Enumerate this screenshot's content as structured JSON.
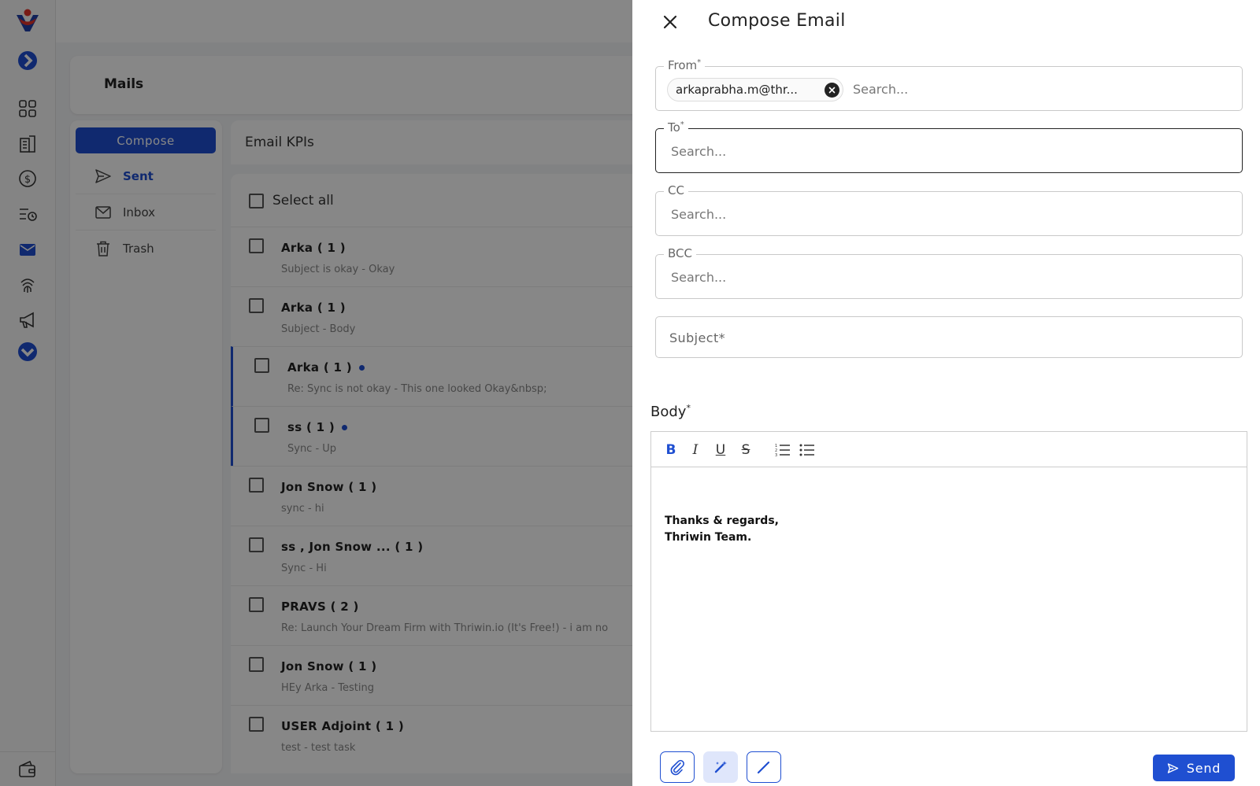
{
  "app": {
    "brand_color": "#1f4fd1",
    "logo_icon": "thriwin-logo-icon"
  },
  "rail": {
    "icons": [
      "expand-chevron-icon",
      "dashboard-grid-icon",
      "building-icon",
      "dollar-icon",
      "list-clock-icon",
      "mail-icon",
      "fingerprint-icon",
      "megaphone-icon",
      "more-chevron-icon",
      "wallet-icon"
    ]
  },
  "page": {
    "title": "Mails"
  },
  "folders": {
    "compose_label": "Compose",
    "items": [
      {
        "label": "Sent",
        "icon": "send-icon",
        "active": true
      },
      {
        "label": "Inbox",
        "icon": "inbox-icon",
        "active": false
      },
      {
        "label": "Trash",
        "icon": "trash-icon",
        "active": false
      }
    ]
  },
  "list": {
    "header": "Email KPIs",
    "select_all": "Select all",
    "rows": [
      {
        "name": "Arka ( 1 )",
        "snippet": "Subject is okay -  Okay",
        "unread": false
      },
      {
        "name": "Arka ( 1 )",
        "snippet": "Subject -  Body",
        "unread": false
      },
      {
        "name": "Arka ( 1 )",
        "snippet": "Re: Sync is not okay -  This one looked Okay&nbsp;",
        "unread": true
      },
      {
        "name": "ss ( 1 )",
        "snippet": "Sync -  Up",
        "unread": true
      },
      {
        "name": "Jon Snow ( 1 )",
        "snippet": "sync -  hi",
        "unread": false
      },
      {
        "name": "ss ,   Jon Snow ... ( 1 )",
        "snippet": "Sync -  Hi",
        "unread": false
      },
      {
        "name": "PRAVS ( 2 )",
        "snippet": "Re: Launch Your Dream Firm with Thriwin.io (It's Free!) -  i am no",
        "unread": false
      },
      {
        "name": "Jon Snow ( 1 )",
        "snippet": "HEy Arka -  Testing",
        "unread": false
      },
      {
        "name": "USER Adjoint ( 1 )",
        "snippet": "test -  test task",
        "unread": false
      }
    ]
  },
  "compose": {
    "title": "Compose Email",
    "from": {
      "label": "From",
      "chip": "arkaprabha.m@thr...",
      "placeholder": "Search..."
    },
    "to": {
      "label": "To",
      "placeholder": "Search..."
    },
    "cc": {
      "label": "CC",
      "placeholder": "Search..."
    },
    "bcc": {
      "label": "BCC",
      "placeholder": "Search..."
    },
    "subject": {
      "placeholder": "Subject",
      "required_mark": "*"
    },
    "required_mark": "*",
    "body_label": "Body",
    "toolbar": {
      "bold": "B",
      "italic": "I",
      "underline": "U",
      "strike": "S"
    },
    "signature_line1": "Thanks & regards,",
    "signature_line2": "Thriwin Team.",
    "send_label": "Send"
  }
}
